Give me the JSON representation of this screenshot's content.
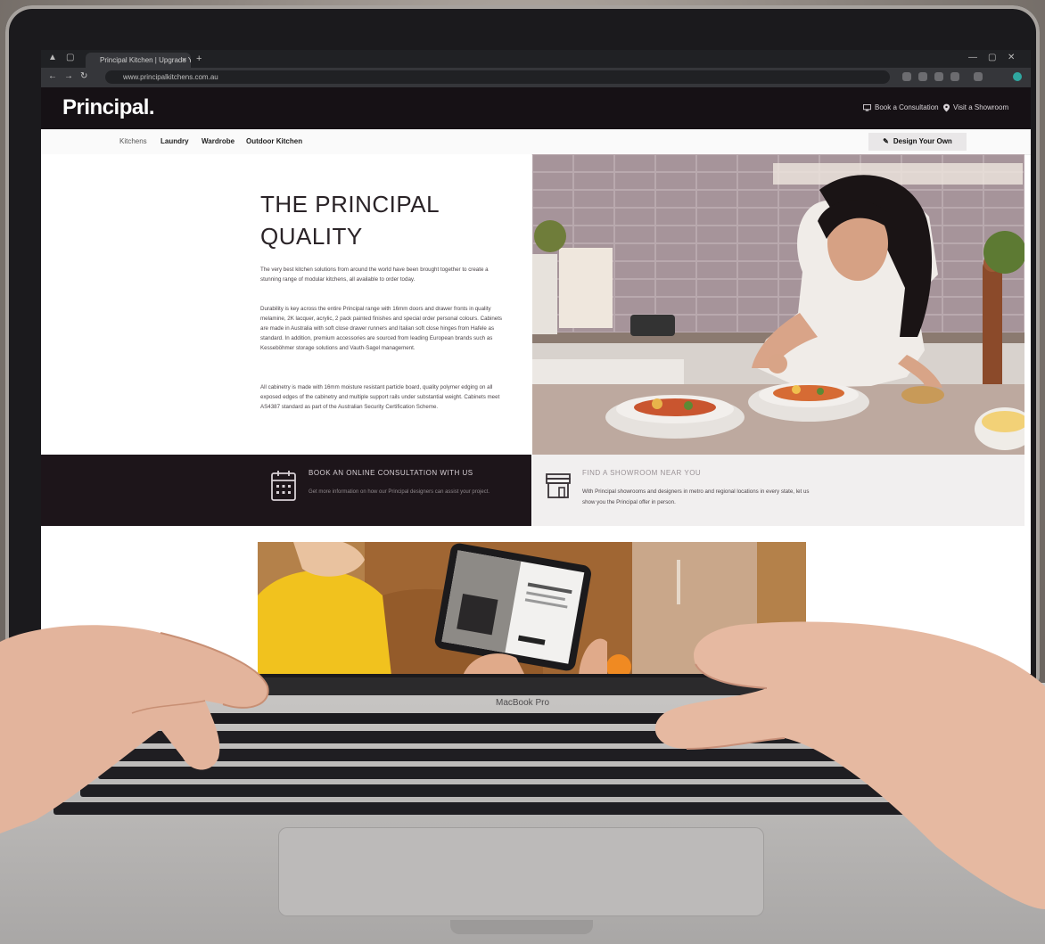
{
  "browser": {
    "tab_title": "Principal Kitchen | Upgrade Your",
    "url": "www.principalkitchens.com.au",
    "new_tab": "+"
  },
  "header": {
    "logo": "Principal.",
    "book_consultation": "Book a Consultation",
    "visit_showroom": "Visit a Showroom"
  },
  "subnav": {
    "items": [
      "Kitchens",
      "Laundry",
      "Wardrobe",
      "Outdoor Kitchen"
    ],
    "design_button": "Design Your Own"
  },
  "hero": {
    "title_line1": "THE PRINCIPAL",
    "title_line2": "QUALITY",
    "paragraphs": [
      "The very best kitchen solutions from around the world have been brought together to create a stunning range of modular kitchens, all available to order today.",
      "Durability is key across the entire Principal range with 16mm doors and drawer fronts in quality melamine, 2K lacquer, acrylic, 2 pack painted finishes and special order personal colours. Cabinets are made in Australia with soft close drawer runners and Italian soft close hinges from Hafele as standard. In addition, premium accessories are sourced from leading European brands such as Kesseböhmer storage solutions and Vauth-Sagel management.",
      "All cabinetry is made with 16mm moisture resistant particle board, quality polymer edging on all exposed edges of the cabinetry and multiple support rails under substantial weight. Cabinets meet AS4387 standard as part of the Australian Security Certification Scheme."
    ]
  },
  "cta": {
    "consult_title": "BOOK AN ONLINE CONSULTATION WITH US",
    "consult_desc": "Get more information on how our Principal designers can assist your project.",
    "showroom_title": "FIND A SHOWROOM NEAR YOU",
    "showroom_desc": "With Principal showrooms and designers in metro and regional locations in every state, let us show you the Principal offer in person."
  },
  "device": {
    "hinge_label": "MacBook Pro"
  },
  "colors": {
    "header_bg": "#161115",
    "cta_dark": "#1d151a",
    "cta_light": "#f1efef",
    "text_dark": "#2a2327"
  },
  "icons": [
    "calendar-icon",
    "store-icon",
    "location-pin-icon",
    "monitor-icon",
    "pencil-ruler-icon"
  ]
}
